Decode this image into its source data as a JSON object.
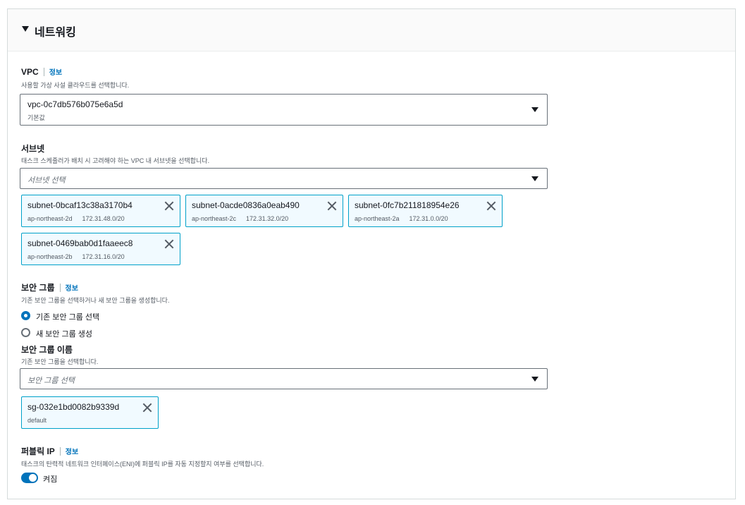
{
  "section": {
    "title": "네트워킹"
  },
  "vpc": {
    "label": "VPC",
    "info": "정보",
    "description": "사용할 가상 사설 클라우드를 선택합니다.",
    "selected_value": "vpc-0c7db576b075e6a5d",
    "selected_sub": "기본값"
  },
  "subnet": {
    "label": "서브넷",
    "description": "태스크 스케줄러가 배치 시 고려해야 하는 VPC 내 서브넷을 선택합니다.",
    "placeholder": "서브넷 선택",
    "tokens": [
      {
        "name": "subnet-0bcaf13c38a3170b4",
        "az": "ap-northeast-2d",
        "cidr": "172.31.48.0/20"
      },
      {
        "name": "subnet-0acde0836a0eab490",
        "az": "ap-northeast-2c",
        "cidr": "172.31.32.0/20"
      },
      {
        "name": "subnet-0fc7b211818954e26",
        "az": "ap-northeast-2a",
        "cidr": "172.31.0.0/20"
      },
      {
        "name": "subnet-0469bab0d1faaeec8",
        "az": "ap-northeast-2b",
        "cidr": "172.31.16.0/20"
      }
    ]
  },
  "security_group": {
    "label": "보안 그룹",
    "info": "정보",
    "description": "기존 보안 그룹을 선택하거나 새 보안 그룹을 생성합니다.",
    "options": [
      {
        "label": "기존 보안 그룹 선택",
        "checked": true
      },
      {
        "label": "새 보안 그룹 생성",
        "checked": false
      }
    ],
    "name_label": "보안 그룹 이름",
    "name_description": "기존 보안 그룹을 선택합니다.",
    "placeholder": "보안 그룹 선택",
    "tokens": [
      {
        "name": "sg-032e1bd0082b9339d",
        "sub": "default"
      }
    ]
  },
  "public_ip": {
    "label": "퍼블릭 IP",
    "info": "정보",
    "description": "태스크의 탄력적 네트워크 인터페이스(ENI)에 퍼블릭 IP를 자동 지정할지 여부를 선택합니다.",
    "toggle_label": "켜짐",
    "enabled": true
  },
  "colors": {
    "accent": "#0073bb",
    "token_border": "#00a1c9",
    "token_bg": "#f1faff"
  }
}
